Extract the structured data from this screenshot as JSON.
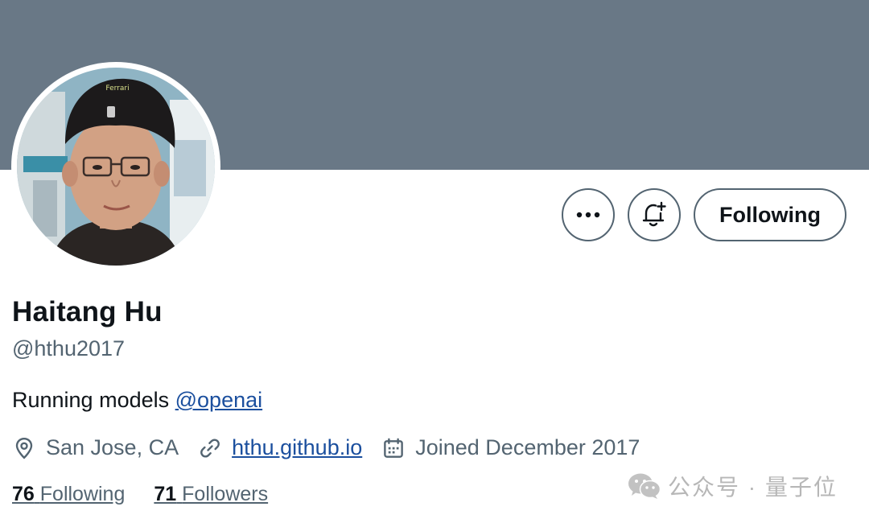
{
  "profile": {
    "name": "Haitang Hu",
    "handle": "@hthu2017",
    "bio_text": "Running models ",
    "bio_mention": "@openai",
    "location": "San Jose, CA",
    "website": "hthu.github.io",
    "joined": "Joined December 2017"
  },
  "stats": {
    "following_count": "76",
    "following_label": "Following",
    "followers_count": "71",
    "followers_label": "Followers"
  },
  "actions": {
    "more_icon": "ellipsis-icon",
    "notify_icon": "bell-plus-icon",
    "follow_label": "Following"
  },
  "watermark": {
    "text": "公众号 · 量子位",
    "icon": "wechat-icon"
  },
  "colors": {
    "banner": "#697886",
    "text_primary": "#0f1419",
    "text_secondary": "#536471",
    "link": "#1b4f9e"
  }
}
